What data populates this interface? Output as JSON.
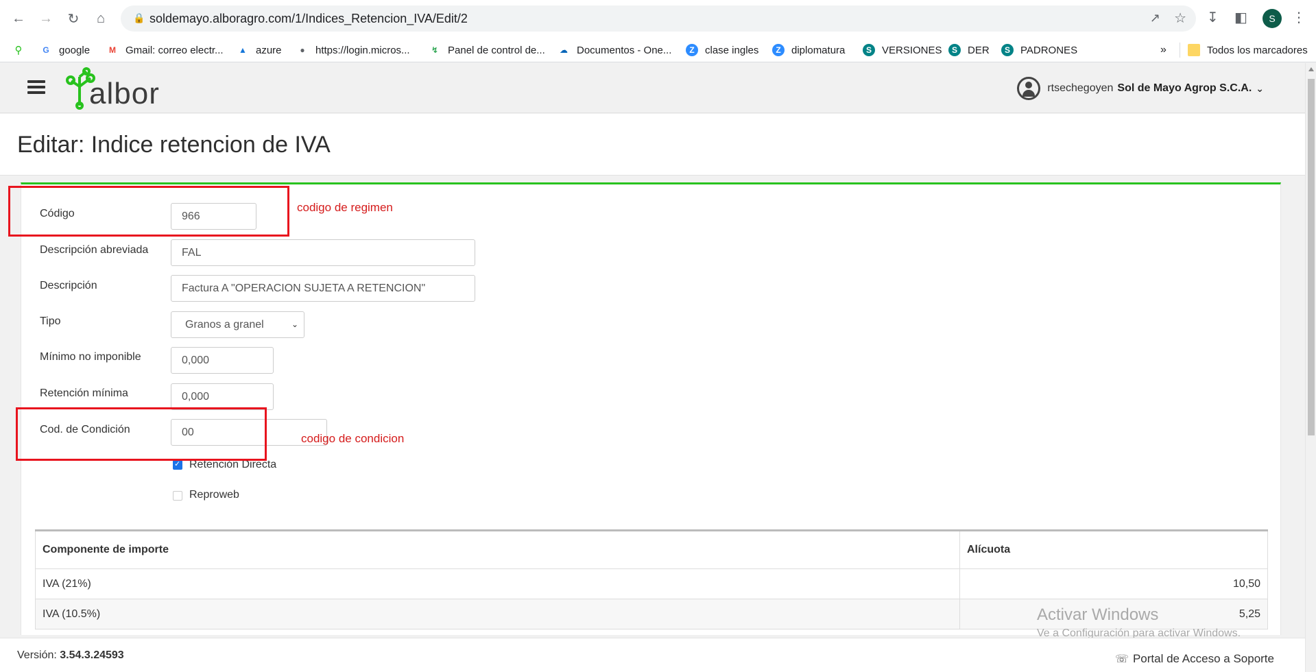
{
  "browser": {
    "url": "soldemayo.alboragro.com/1/Indices_Retencion_IVA/Edit/2",
    "profile_initial": "S",
    "bookmarks": [
      {
        "label": "google",
        "icon": "google-icon"
      },
      {
        "label": "Gmail: correo electr...",
        "icon": "gmail-icon"
      },
      {
        "label": "azure",
        "icon": "azure-icon"
      },
      {
        "label": "https://login.micros...",
        "icon": "globe-icon"
      },
      {
        "label": "Panel de control de...",
        "icon": "panel-icon"
      },
      {
        "label": "Documentos - One...",
        "icon": "onedrive-icon"
      },
      {
        "label": "clase ingles",
        "icon": "zoom-icon"
      },
      {
        "label": "diplomatura",
        "icon": "zoom-icon"
      },
      {
        "label": "VERSIONES",
        "icon": "sharepoint-icon"
      },
      {
        "label": "DER",
        "icon": "sharepoint-icon"
      },
      {
        "label": "PADRONES",
        "icon": "sharepoint-icon"
      }
    ],
    "overflow": "»",
    "all_bookmarks": "Todos los marcadores"
  },
  "header": {
    "logo_text": "albor",
    "username": "rtsechegoyen",
    "company": "Sol de Mayo Agrop S.C.A.",
    "brand_color": "#28c21e"
  },
  "page": {
    "title": "Editar: Indice retencion de IVA"
  },
  "form": {
    "codigo": {
      "label": "Código",
      "value": "966"
    },
    "desc_abrev": {
      "label": "Descripción abreviada",
      "value": "FAL"
    },
    "descripcion": {
      "label": "Descripción",
      "value": "Factura A \"OPERACION SUJETA A RETENCION\""
    },
    "tipo": {
      "label": "Tipo",
      "value": "Granos a granel"
    },
    "minimo": {
      "label": "Mínimo no imponible",
      "value": "0,000"
    },
    "retencion_min": {
      "label": "Retención mínima",
      "value": "0,000"
    },
    "cod_condicion": {
      "label": "Cod. de Condición",
      "value": "00"
    },
    "ret_directa": {
      "label": "Retención Directa",
      "checked": true
    },
    "reproweb": {
      "label": "Reproweb",
      "checked": false
    }
  },
  "annotations": {
    "regimen": "codigo de regimen",
    "condicion": "codigo de condicion",
    "color": "#e8141e"
  },
  "table": {
    "headers": [
      "Componente de importe",
      "Alícuota"
    ],
    "rows": [
      [
        "IVA (21%)",
        "10,50"
      ],
      [
        "IVA (10.5%)",
        "5,25"
      ]
    ]
  },
  "footer": {
    "version_label": "Versión:",
    "version": "3.54.3.24593",
    "support": "Portal de Acceso a Soporte"
  },
  "watermark": {
    "line1": "Activar Windows",
    "line2": "Ve a Configuración para activar Windows."
  }
}
